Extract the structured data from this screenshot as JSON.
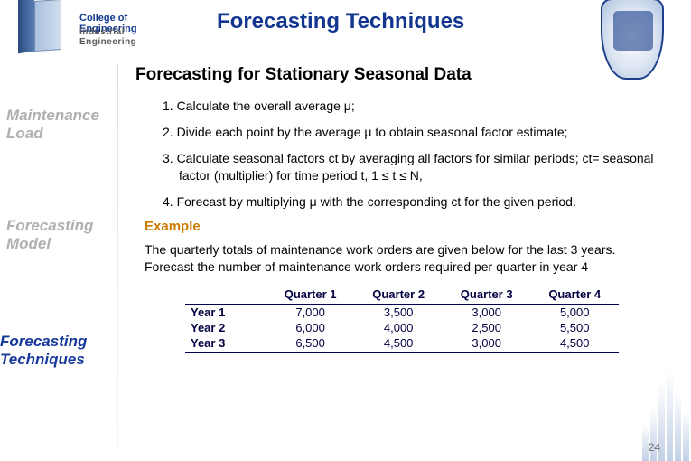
{
  "header": {
    "college": "College of Engineering",
    "dept": "Industrial Engineering",
    "title": "Forecasting Techniques"
  },
  "sidebar": {
    "item1": "Maintenance\nLoad",
    "item2": "Forecasting\nModel",
    "item3": "Forecasting\nTechniques"
  },
  "subtitle": "Forecasting for Stationary Seasonal Data",
  "steps": {
    "s1": "1. Calculate the overall average μ;",
    "s2": "2. Divide each point by the average μ to obtain seasonal factor estimate;",
    "s3": "3. Calculate seasonal factors ct by averaging all factors for similar periods; ct= seasonal factor (multiplier) for time period t, 1 ≤ t ≤ N,",
    "s4": "4. Forecast by multiplying μ with the corresponding ct for the given period."
  },
  "example": {
    "head": "Example",
    "body": "The quarterly totals of maintenance work orders are given below for the last 3 years. Forecast the number of maintenance work orders required per quarter in year 4"
  },
  "table": {
    "cols": [
      "",
      "Quarter 1",
      "Quarter 2",
      "Quarter 3",
      "Quarter 4"
    ],
    "rows": [
      {
        "h": "Year 1",
        "v": [
          "7,000",
          "3,500",
          "3,000",
          "5,000"
        ]
      },
      {
        "h": "Year 2",
        "v": [
          "6,000",
          "4,000",
          "2,500",
          "5,500"
        ]
      },
      {
        "h": "Year 3",
        "v": [
          "6,500",
          "4,500",
          "3,000",
          "4,500"
        ]
      }
    ]
  },
  "pagenum": "24"
}
